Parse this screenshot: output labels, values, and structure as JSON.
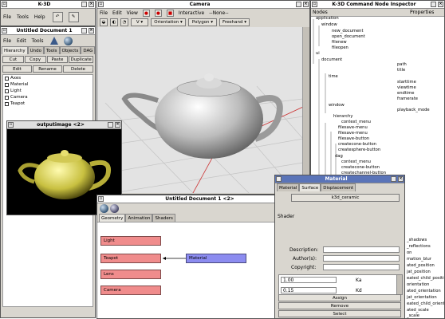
{
  "k3d": {
    "title": "K-3D",
    "menu": [
      "File",
      "Tools",
      "Help"
    ]
  },
  "doc": {
    "title": "Untitled Document 1",
    "menu": [
      "File",
      "Edit",
      "Tools"
    ],
    "tabs": [
      "Hierarchy",
      "Undo",
      "Tools",
      "Objects",
      "DAG"
    ],
    "buttons_row1": [
      "Cut",
      "Copy",
      "Paste",
      "Duplicate"
    ],
    "buttons_row2": [
      "Edit",
      "Rename",
      "Delete"
    ],
    "tree": [
      "Axes",
      "Material",
      "Light",
      "Camera",
      "Teapot"
    ]
  },
  "output": {
    "title": "outputimage <2>"
  },
  "camera": {
    "title": "Camera",
    "menu": [
      "File",
      "Edit",
      "View"
    ],
    "toolbar": {
      "interactive": "Interactive",
      "none": "--None--",
      "v": "V",
      "orientation": "Orientation",
      "polygon": "Polygon",
      "freehand": "Freehand"
    }
  },
  "doc2": {
    "title": "Untitled Document 1 <2>",
    "tabs": [
      "Geometry",
      "Animation",
      "Shaders"
    ],
    "nodes": {
      "light": "Light",
      "teapot": "Teapot",
      "material": "Material",
      "lens": "Lens",
      "camera": "Camera"
    }
  },
  "inspector": {
    "title": "K-3D Command Node Inspector",
    "headers": [
      "Nodes",
      "Properties"
    ],
    "tree": [
      "application",
      "window",
      "new_document",
      "open_document",
      "filenew",
      "fileopen",
      "ui",
      "document",
      "path",
      "title",
      "time",
      "starttime",
      "viewtime",
      "endtime",
      "framerate",
      "window",
      "playback_mode",
      "hierarchy",
      "context_menu",
      "filesave-menu",
      "filesave-menu",
      "filesave-button",
      "createcone-button",
      "createsphere-button",
      "dag",
      "context_menu",
      "createcone-button",
      "createchannel-button"
    ],
    "props_bottom": [
      "_shadows",
      "_reflections",
      "on",
      "mation_blur",
      "ated_position",
      "jat_position",
      "eated_child_position",
      "orientation",
      "ated_orientation",
      "jat_orientation",
      "eated_child_orientation",
      "ated_scale",
      "_scale"
    ]
  },
  "material": {
    "title": "Material",
    "tabs": [
      "Material",
      "Surface",
      "Displacement"
    ],
    "shader_name": "k3d_ceramic",
    "shader_label": "Shader",
    "labels": [
      "Description:",
      "Author(s):",
      "Copyright:"
    ],
    "param_value1": "1.00",
    "param_value2": "0.15",
    "param_label1": "Ka",
    "param_label2": "Kd",
    "buttons": [
      "Assign",
      "Remove",
      "Select"
    ]
  }
}
